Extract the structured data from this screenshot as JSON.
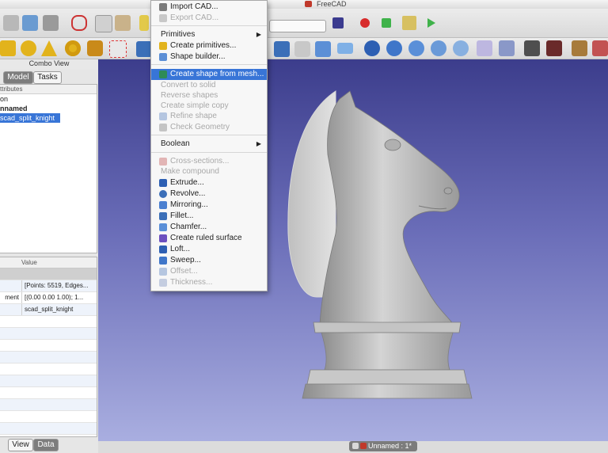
{
  "window": {
    "title": "FreeCAD"
  },
  "combo_view": {
    "title": "Combo View",
    "tabs": [
      "Model",
      "Tasks"
    ]
  },
  "tree": {
    "header": "ttributes",
    "rows": [
      {
        "label": "on"
      },
      {
        "label": "nnamed"
      },
      {
        "label": "scad_split_knight"
      }
    ]
  },
  "properties": {
    "header_value": "Value",
    "rows": [
      {
        "key": "",
        "value": "[Points: 5519, Edges..."
      },
      {
        "key": "ment",
        "value": "[(0.00 0.00 1.00); 1..."
      },
      {
        "key": "",
        "value": "scad_split_knight"
      }
    ]
  },
  "bottom_tabs": [
    "View",
    "Data"
  ],
  "document_tab": {
    "label": "Unnamed : 1*"
  },
  "menu": {
    "items": [
      {
        "label": "Import CAD...",
        "state": "enabled"
      },
      {
        "label": "Export CAD...",
        "state": "disabled"
      },
      {
        "label": "Primitives",
        "state": "submenu"
      },
      {
        "label": "Create primitives...",
        "state": "enabled"
      },
      {
        "label": "Shape builder...",
        "state": "enabled"
      },
      {
        "label": "Create shape from mesh...",
        "state": "highlight"
      },
      {
        "label": "Convert to solid",
        "state": "disabled"
      },
      {
        "label": "Reverse shapes",
        "state": "disabled"
      },
      {
        "label": "Create simple copy",
        "state": "disabled"
      },
      {
        "label": "Refine shape",
        "state": "disabled"
      },
      {
        "label": "Check Geometry",
        "state": "disabled"
      },
      {
        "label": "Boolean",
        "state": "submenu"
      },
      {
        "label": "Cross-sections...",
        "state": "disabled"
      },
      {
        "label": "Make compound",
        "state": "disabled"
      },
      {
        "label": "Extrude...",
        "state": "enabled"
      },
      {
        "label": "Revolve...",
        "state": "enabled"
      },
      {
        "label": "Mirroring...",
        "state": "enabled"
      },
      {
        "label": "Fillet...",
        "state": "enabled"
      },
      {
        "label": "Chamfer...",
        "state": "enabled"
      },
      {
        "label": "Create ruled surface",
        "state": "enabled"
      },
      {
        "label": "Loft...",
        "state": "enabled"
      },
      {
        "label": "Sweep...",
        "state": "enabled"
      },
      {
        "label": "Offset...",
        "state": "disabled"
      },
      {
        "label": "Thickness...",
        "state": "disabled"
      }
    ]
  },
  "colors": {
    "viewport_top": "#3c3d8c",
    "viewport_bottom": "#a9aee0",
    "selection": "#3875d7",
    "model": "#bdbdbd"
  }
}
